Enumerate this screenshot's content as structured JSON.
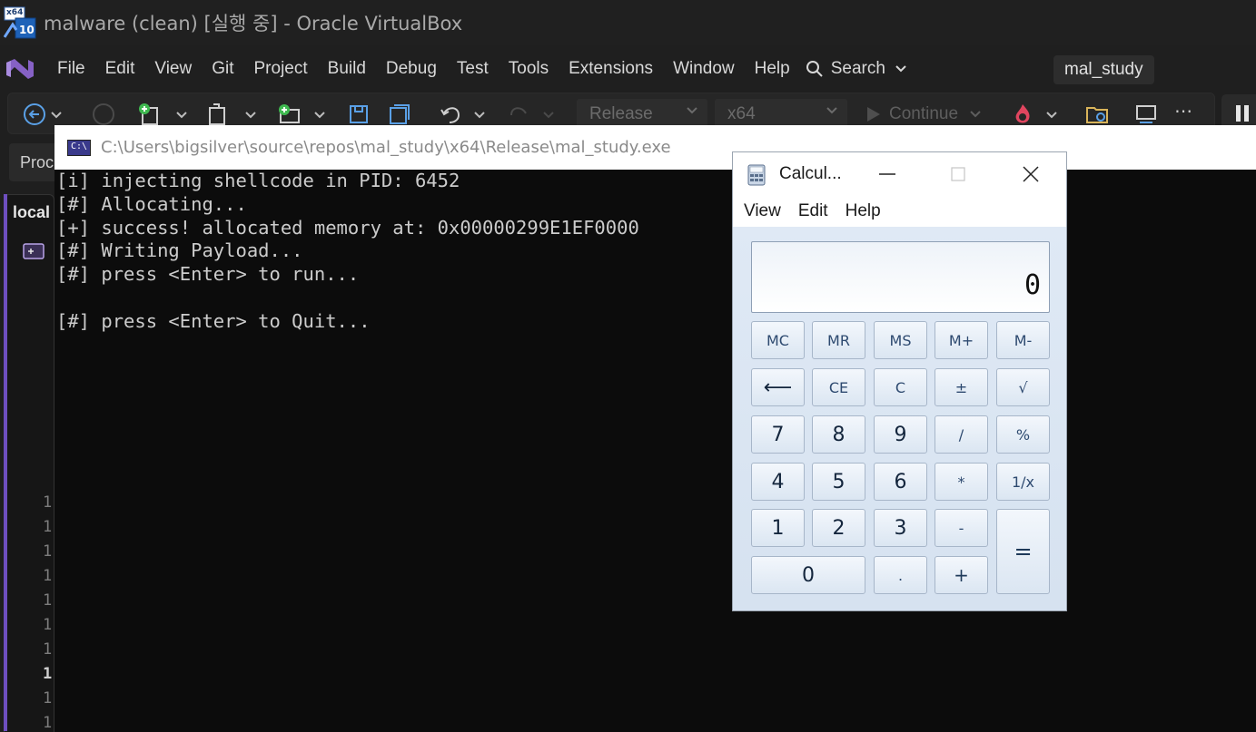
{
  "vbox": {
    "title": "malware (clean) [실행 중] - Oracle VirtualBox",
    "icon_text_top": "x64",
    "icon_text_bottom": "10"
  },
  "vs": {
    "menu": [
      "File",
      "Edit",
      "View",
      "Git",
      "Project",
      "Build",
      "Debug",
      "Test",
      "Tools",
      "Extensions",
      "Window",
      "Help"
    ],
    "search_label": "Search",
    "solution_name": "mal_study",
    "toolbar": {
      "configuration": "Release",
      "platform": "x64",
      "continue_label": "Continue"
    },
    "side_label": "Proc",
    "tab_label": "local",
    "line_numbers": [
      "1",
      "1",
      "1",
      "1",
      "1",
      "1",
      "1",
      "1",
      "1",
      "1"
    ]
  },
  "console": {
    "title": "C:\\Users\\bigsilver\\source\\repos\\mal_study\\x64\\Release\\mal_study.exe",
    "icon_text": "C:\\",
    "lines": [
      "[i] injecting shellcode in PID: 6452",
      "[#] Allocating...",
      "[+] success! allocated memory at: 0x00000299E1EF0000",
      "[#] Writing Payload...",
      "[#] press <Enter> to run...",
      "",
      "[#] press <Enter> to Quit..."
    ]
  },
  "calculator": {
    "title": "Calcul...",
    "menu": [
      "View",
      "Edit",
      "Help"
    ],
    "display": "0",
    "buttons": {
      "mc": "MC",
      "mr": "MR",
      "ms": "MS",
      "mplus": "M+",
      "mminus": "M-",
      "back": "⟵",
      "ce": "CE",
      "c": "C",
      "plusminus": "±",
      "sqrt": "√",
      "d7": "7",
      "d8": "8",
      "d9": "9",
      "div": "/",
      "pct": "%",
      "d4": "4",
      "d5": "5",
      "d6": "6",
      "mul": "*",
      "recip": "1/x",
      "d1": "1",
      "d2": "2",
      "d3": "3",
      "sub": "-",
      "eq": "=",
      "d0": "0",
      "dot": ".",
      "add": "+"
    }
  },
  "colors": {
    "vs_purple": "#6e4fbf",
    "console_bg": "#0c0c0c",
    "calc_bg": "#d6e2f0"
  }
}
